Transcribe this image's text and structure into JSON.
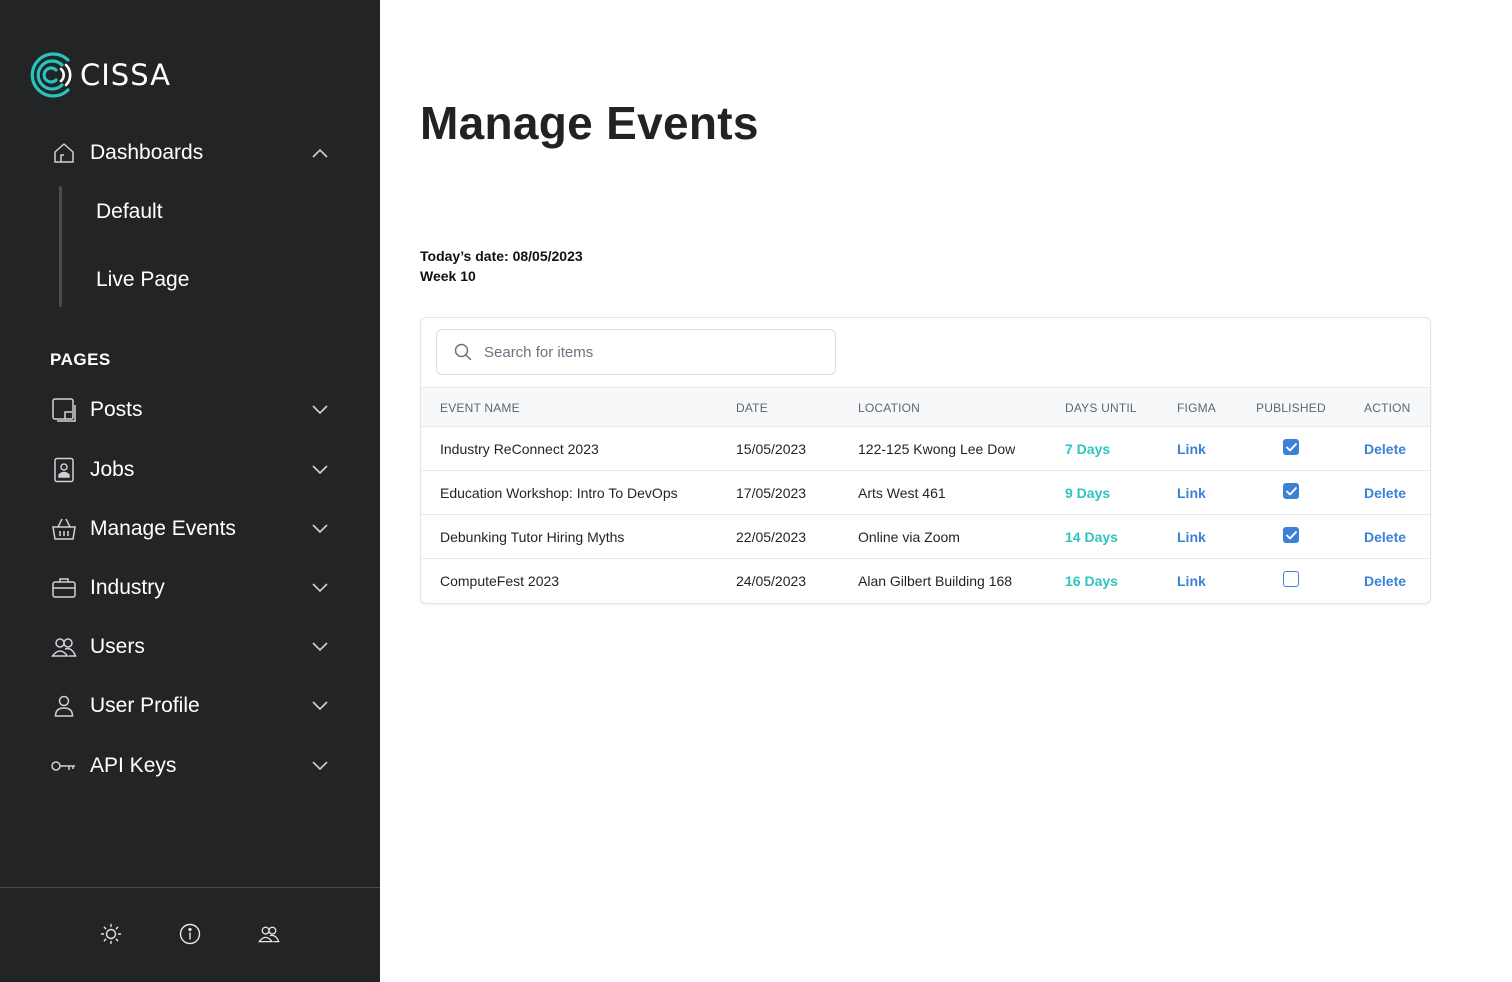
{
  "app": {
    "logo_text": "CISSA"
  },
  "sidebar": {
    "dashboards": {
      "label": "Dashboards",
      "icon": "home-icon",
      "expanded": true
    },
    "sub_items": [
      {
        "label": "Default"
      },
      {
        "label": "Live Page"
      }
    ],
    "section_title": "PAGES",
    "items": [
      {
        "label": "Posts",
        "icon": "posts-icon"
      },
      {
        "label": "Jobs",
        "icon": "id-badge-icon"
      },
      {
        "label": "Manage Events",
        "icon": "basket-icon"
      },
      {
        "label": "Industry",
        "icon": "briefcase-icon"
      },
      {
        "label": "Users",
        "icon": "users-icon"
      },
      {
        "label": "User Profile",
        "icon": "user-icon"
      },
      {
        "label": "API Keys",
        "icon": "key-icon"
      }
    ],
    "footer": [
      "sun-icon",
      "info-icon",
      "users-icon"
    ]
  },
  "main": {
    "title": "Manage Events",
    "today_date": "Today’s date: 08/05/2023",
    "week": "Week 10",
    "search": {
      "placeholder": "Search for items",
      "value": ""
    },
    "columns": [
      "EVENT NAME",
      "DATE",
      "LOCATION",
      "DAYS UNTIL",
      "FIGMA",
      "PUBLISHED",
      "ACTION"
    ],
    "rows": [
      {
        "name": "Industry ReConnect 2023",
        "date": "15/05/2023",
        "location": "122-125 Kwong Lee Dow",
        "days": "7 Days",
        "figma": "Link",
        "published": true,
        "action": "Delete"
      },
      {
        "name": "Education Workshop: Intro To DevOps",
        "date": "17/05/2023",
        "location": "Arts West 461",
        "days": "9 Days",
        "figma": "Link",
        "published": true,
        "action": "Delete"
      },
      {
        "name": "Debunking Tutor Hiring Myths",
        "date": "22/05/2023",
        "location": "Online via Zoom",
        "days": "14 Days",
        "figma": "Link",
        "published": true,
        "action": "Delete"
      },
      {
        "name": "ComputeFest 2023",
        "date": "24/05/2023",
        "location": "Alan Gilbert Building 168",
        "days": "16 Days",
        "figma": "Link",
        "published": false,
        "action": "Delete"
      }
    ]
  },
  "colors": {
    "sidebar_bg": "#232425",
    "accent_teal": "#2ec4c0",
    "link_blue": "#3b82d6"
  }
}
